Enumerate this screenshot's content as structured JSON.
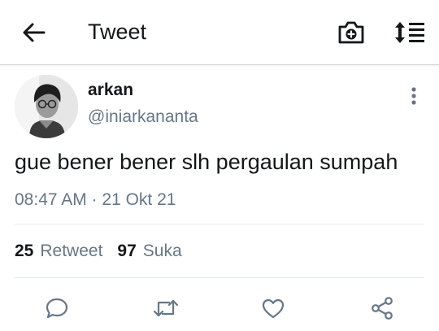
{
  "header": {
    "title": "Tweet",
    "icons": {
      "back": "arrow-left-icon",
      "camera": "camera-plus-icon",
      "sort": "sort-list-icon"
    }
  },
  "tweet": {
    "author_name": "arkan",
    "author_handle": "@iniarkananta",
    "text": "gue bener bener slh pergaulan sumpah",
    "timestamp": "08:47 AM · 21 Okt 21",
    "more_icon": "more-vertical-icon"
  },
  "stats": {
    "retweets_count": "25",
    "retweets_label": "Retweet",
    "likes_count": "97",
    "likes_label": "Suka"
  },
  "actions": [
    {
      "icon": "reply-icon"
    },
    {
      "icon": "retweet-icon"
    },
    {
      "icon": "heart-icon"
    },
    {
      "icon": "share-icon"
    }
  ],
  "colors": {
    "text_primary": "#14171a",
    "text_secondary": "#657786",
    "divider": "#e1e8ed",
    "icon_gray": "#657786"
  }
}
